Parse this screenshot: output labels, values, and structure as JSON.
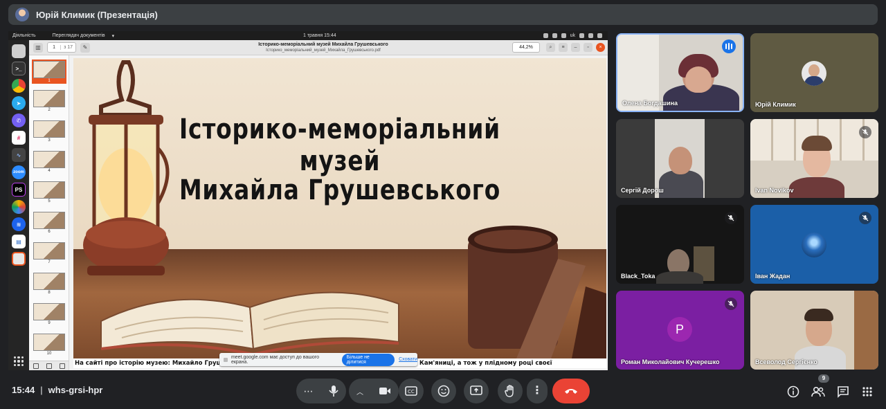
{
  "header": {
    "title": "Юрій Климик (Презентація)"
  },
  "desktop": {
    "activities": "Діяльність",
    "app_menu": "Переглядач документів",
    "clock": "1 травня  15:44",
    "keyboard_layout": "uk"
  },
  "viewer": {
    "page_current": "1",
    "page_total": "з 17",
    "doc_title": "Історико-меморіальний музей Михайла Грушевського",
    "doc_subtitle": "Історико_меморіальний_музей_Михайла_Грушевського.pdf",
    "zoom": "44,2%",
    "thumbnails": [
      "1",
      "2",
      "3",
      "4",
      "5",
      "6",
      "7",
      "8",
      "9",
      "10"
    ]
  },
  "slide": {
    "title_line1": "Історико-меморіальний музей",
    "title_line2": "Михайла Грушевського",
    "caption": "На сайті про історію музею: Михайло Грушевський сотні разів порушував питання своєї будинки на Кам'яниці, а тож у плідному році своєї"
  },
  "share_banner": {
    "text": "meet.google.com має доступ до вашого екрана.",
    "stop_label": "Більше не ділитися",
    "hide_label": "Сховати"
  },
  "participants": [
    {
      "name": "Олена Богдашина",
      "state": "speaking"
    },
    {
      "name": "Юрій Климик",
      "state": "normal"
    },
    {
      "name": "Сергій Дорош",
      "state": "normal"
    },
    {
      "name": "Ivan Novikov",
      "state": "muted"
    },
    {
      "name": "Black_Toka",
      "state": "muted"
    },
    {
      "name": "Іван Жадан",
      "state": "muted"
    },
    {
      "name": "Роман Миколайович Кучерешко",
      "initial": "Р",
      "state": "muted"
    },
    {
      "name": "Всеволод Сергієнко",
      "state": "normal"
    }
  ],
  "footer": {
    "time": "15:44",
    "meeting_code": "whs-grsi-hpr",
    "people_count": "9"
  },
  "colors": {
    "bg": "#202124",
    "control": "#3c4043",
    "end_call": "#ea4335",
    "accent_blue": "#1a73e8",
    "ubuntu_orange": "#e95420"
  }
}
